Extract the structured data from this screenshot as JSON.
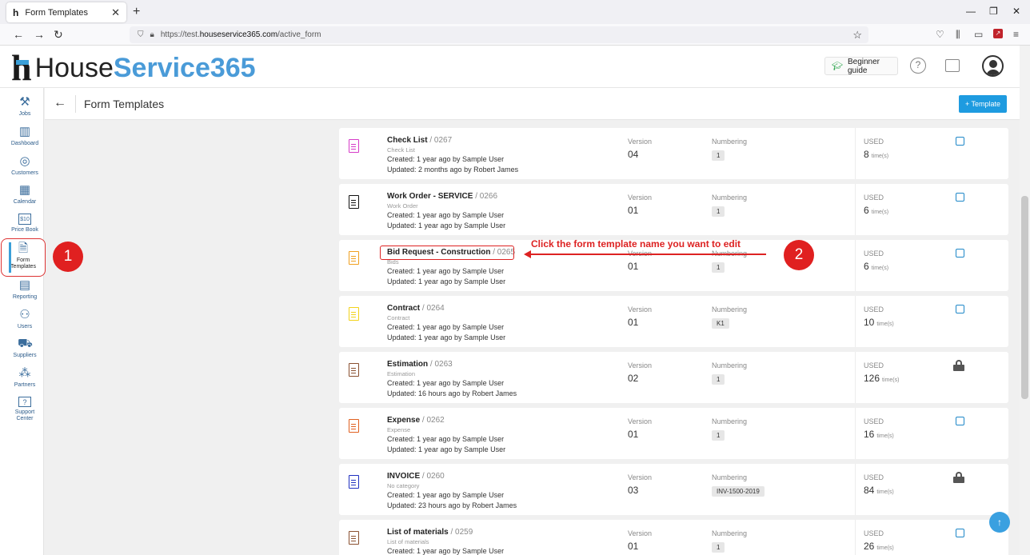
{
  "browser": {
    "tab_title": "Form Templates",
    "tab_favicon": "h",
    "tab_close": "✕",
    "new_tab": "+",
    "url_prefix": "https://test.",
    "url_domain": "houseservice365.com",
    "url_path": "/active_form",
    "minimize": "—",
    "restore": "❐",
    "close": "✕"
  },
  "header": {
    "logo_part1": "House",
    "logo_part2": "Service365",
    "guide_label": "Beginner guide"
  },
  "sidebar": {
    "items": [
      {
        "label": "Jobs",
        "icon": "tools-icon"
      },
      {
        "label": "Dashboard",
        "icon": "bar-chart-icon"
      },
      {
        "label": "Customers",
        "icon": "customers-icon"
      },
      {
        "label": "Calendar",
        "icon": "calendar-icon"
      },
      {
        "label": "Price Book",
        "icon": "pricebook-icon"
      },
      {
        "label": "Form Templates",
        "icon": "form-templates-icon"
      },
      {
        "label": "Reporting",
        "icon": "reporting-icon"
      },
      {
        "label": "Users",
        "icon": "users-icon"
      },
      {
        "label": "Suppliers",
        "icon": "truck-icon"
      },
      {
        "label": "Partners",
        "icon": "partners-icon"
      },
      {
        "label": "Support Center",
        "icon": "support-icon"
      }
    ],
    "pricebook_badge": "$10"
  },
  "content": {
    "title": "Form Templates",
    "template_button": "+ Template"
  },
  "labels": {
    "version": "Version",
    "numbering": "Numbering",
    "used": "USED",
    "times": "time(s)"
  },
  "rows": [
    {
      "name": "Check List",
      "code": "/ 0267",
      "category": "Check List",
      "created": "Created: 1 year ago by Sample User",
      "updated": "Updated: 2 months ago by Robert James",
      "version": "04",
      "numbering": "1",
      "used": "8",
      "control": "checkbox",
      "icon_color": "#d63cc8"
    },
    {
      "name": "Work Order - SERVICE",
      "code": "/ 0266",
      "category": "Work Order",
      "created": "Created: 1 year ago by Sample User",
      "updated": "Updated: 1 year ago by Sample User",
      "version": "01",
      "numbering": "1",
      "used": "6",
      "control": "checkbox",
      "icon_color": "#111111"
    },
    {
      "name": "Bid Request - Construction",
      "code": "/ 0265",
      "category": "Bids",
      "created": "Created: 1 year ago by Sample User",
      "updated": "Updated: 1 year ago by Sample User",
      "version": "01",
      "numbering": "1",
      "used": "6",
      "control": "checkbox",
      "icon_color": "#f0a020"
    },
    {
      "name": "Contract",
      "code": "/ 0264",
      "category": "Contract",
      "created": "Created: 1 year ago by Sample User",
      "updated": "Updated: 1 year ago by Sample User",
      "version": "01",
      "numbering": "K1",
      "used": "10",
      "control": "checkbox",
      "icon_color": "#f2d21a"
    },
    {
      "name": "Estimation",
      "code": "/ 0263",
      "category": "Estimation",
      "created": "Created: 1 year ago by Sample User",
      "updated": "Updated: 16 hours ago by Robert James",
      "version": "02",
      "numbering": "1",
      "used": "126",
      "control": "lock",
      "icon_color": "#8a5030"
    },
    {
      "name": "Expense",
      "code": "/ 0262",
      "category": "Expense",
      "created": "Created: 1 year ago by Sample User",
      "updated": "Updated: 1 year ago by Sample User",
      "version": "01",
      "numbering": "1",
      "used": "16",
      "control": "checkbox",
      "icon_color": "#e06020"
    },
    {
      "name": "INVOICE",
      "code": "/ 0260",
      "category": "No category",
      "created": "Created: 1 year ago by Sample User",
      "updated": "Updated: 23 hours ago by Robert James",
      "version": "03",
      "numbering": "INV-1500-2019",
      "used": "84",
      "control": "lock",
      "icon_color": "#2030c0"
    },
    {
      "name": "List of materials",
      "code": "/ 0259",
      "category": "List of materials",
      "created": "Created: 1 year ago by Sample User",
      "updated": "",
      "version": "01",
      "numbering": "1",
      "used": "26",
      "control": "checkbox",
      "icon_color": "#8a5030"
    }
  ],
  "annotations": {
    "badge1": "1",
    "badge2": "2",
    "instruction": "Click the form template name you want to edit"
  },
  "colors": {
    "accent": "#1e9be0",
    "annotation": "#e02020"
  }
}
